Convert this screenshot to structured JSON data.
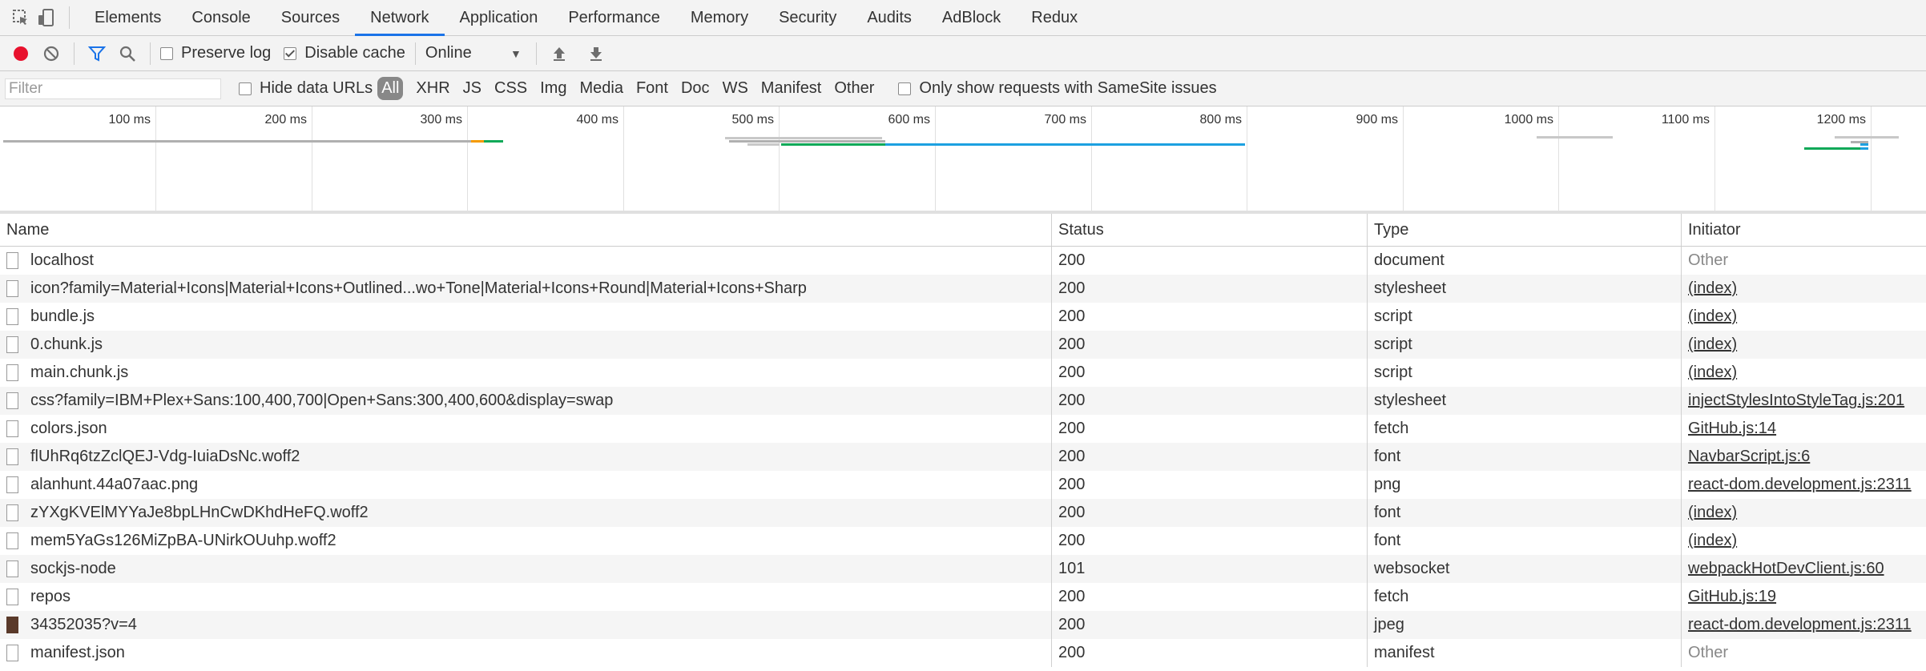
{
  "tabs": [
    "Elements",
    "Console",
    "Sources",
    "Network",
    "Application",
    "Performance",
    "Memory",
    "Security",
    "Audits",
    "AdBlock",
    "Redux"
  ],
  "selected_tab": "Network",
  "toolbar": {
    "preserve_log": "Preserve log",
    "disable_cache": "Disable cache",
    "throttle": "Online",
    "preserve_log_checked": false,
    "disable_cache_checked": true
  },
  "filterbar": {
    "placeholder": "Filter",
    "hide_data_urls": "Hide data URLs",
    "types": [
      "All",
      "XHR",
      "JS",
      "CSS",
      "Img",
      "Media",
      "Font",
      "Doc",
      "WS",
      "Manifest",
      "Other"
    ],
    "samesite": "Only show requests with SameSite issues"
  },
  "overview": {
    "ticks": [
      "100 ms",
      "200 ms",
      "300 ms",
      "400 ms",
      "500 ms",
      "600 ms",
      "700 ms",
      "800 ms",
      "900 ms",
      "1000 ms",
      "1100 ms",
      "1200 ms"
    ]
  },
  "columns": [
    "Name",
    "Status",
    "Type",
    "Initiator"
  ],
  "rows": [
    {
      "name": "localhost",
      "status": "200",
      "type": "document",
      "initiator": "Other",
      "link": false,
      "icon": "file-icon"
    },
    {
      "name": "icon?family=Material+Icons|Material+Icons+Outlined...wo+Tone|Material+Icons+Round|Material+Icons+Sharp",
      "status": "200",
      "type": "stylesheet",
      "initiator": "(index)",
      "link": true,
      "icon": "file-icon"
    },
    {
      "name": "bundle.js",
      "status": "200",
      "type": "script",
      "initiator": "(index)",
      "link": true,
      "icon": "file-icon"
    },
    {
      "name": "0.chunk.js",
      "status": "200",
      "type": "script",
      "initiator": "(index)",
      "link": true,
      "icon": "file-icon"
    },
    {
      "name": "main.chunk.js",
      "status": "200",
      "type": "script",
      "initiator": "(index)",
      "link": true,
      "icon": "file-icon"
    },
    {
      "name": "css?family=IBM+Plex+Sans:100,400,700|Open+Sans:300,400,600&display=swap",
      "status": "200",
      "type": "stylesheet",
      "initiator": "injectStylesIntoStyleTag.js:201",
      "link": true,
      "icon": "file-icon"
    },
    {
      "name": "colors.json",
      "status": "200",
      "type": "fetch",
      "initiator": "GitHub.js:14",
      "link": true,
      "icon": "file-icon"
    },
    {
      "name": "flUhRq6tzZclQEJ-Vdg-IuiaDsNc.woff2",
      "status": "200",
      "type": "font",
      "initiator": "NavbarScript.js:6",
      "link": true,
      "icon": "file-icon"
    },
    {
      "name": "alanhunt.44a07aac.png",
      "status": "200",
      "type": "png",
      "initiator": "react-dom.development.js:2311",
      "link": true,
      "icon": "file-icon"
    },
    {
      "name": "zYXgKVElMYYaJe8bpLHnCwDKhdHeFQ.woff2",
      "status": "200",
      "type": "font",
      "initiator": "(index)",
      "link": true,
      "icon": "file-icon"
    },
    {
      "name": "mem5YaGs126MiZpBA-UNirkOUuhp.woff2",
      "status": "200",
      "type": "font",
      "initiator": "(index)",
      "link": true,
      "icon": "file-icon"
    },
    {
      "name": "sockjs-node",
      "status": "101",
      "type": "websocket",
      "initiator": "webpackHotDevClient.js:60",
      "link": true,
      "icon": "file-icon"
    },
    {
      "name": "repos",
      "status": "200",
      "type": "fetch",
      "initiator": "GitHub.js:19",
      "link": true,
      "icon": "file-icon"
    },
    {
      "name": "34352035?v=4",
      "status": "200",
      "type": "jpeg",
      "initiator": "react-dom.development.js:2311",
      "link": true,
      "icon": "image-thumbnail-icon"
    },
    {
      "name": "manifest.json",
      "status": "200",
      "type": "manifest",
      "initiator": "Other",
      "link": false,
      "icon": "file-icon"
    }
  ],
  "colors": {
    "record": "#e8112d",
    "accent": "#1a73e8",
    "green": "#0fa958",
    "blue": "#1ca0e0",
    "orange": "#f59a00",
    "gray": "#b0b0b0"
  }
}
